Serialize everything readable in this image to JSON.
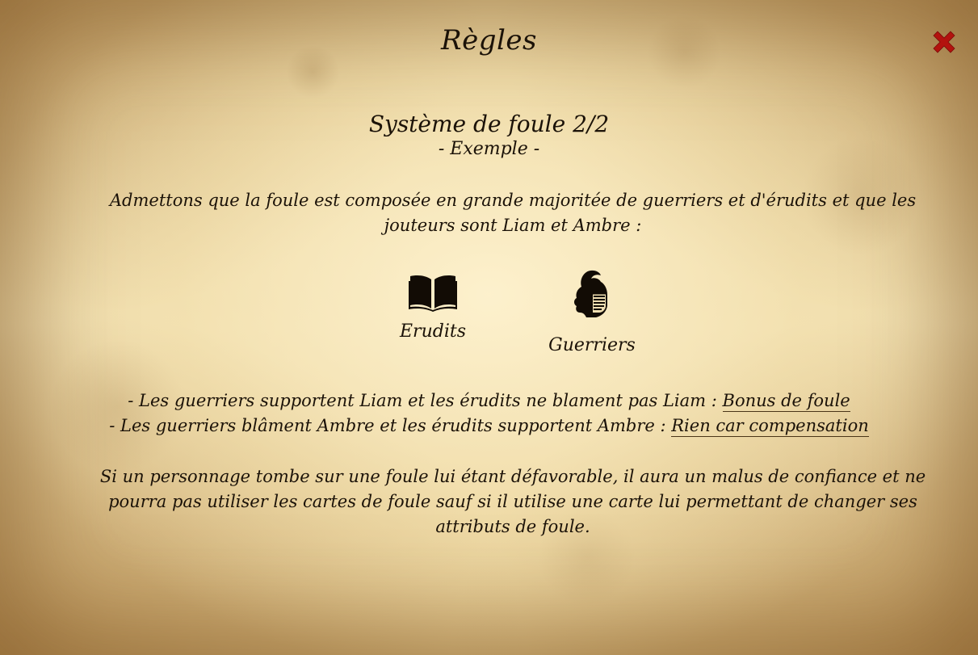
{
  "header": {
    "title": "Règles",
    "close_icon": "close-x-icon",
    "close_color": "#b3120e"
  },
  "section": {
    "title": "Système de foule 2/2",
    "subtitle": "- Exemple -"
  },
  "intro": "Admettons que la foule est composée en grande majoritée de guerriers et d'érudits et que les jouteurs sont Liam et Ambre :",
  "crowd_types": [
    {
      "icon": "open-book-icon",
      "label": "Erudits"
    },
    {
      "icon": "knight-helmet-icon",
      "label": "Guerriers"
    }
  ],
  "examples": [
    {
      "text": "- Les guerriers supportent Liam et les érudits ne blament pas Liam : ",
      "result": "Bonus de foule"
    },
    {
      "text": "- Les guerriers blâment Ambre et les érudits supportent Ambre : ",
      "result": "Rien car compensation"
    }
  ],
  "conclusion": "Si un personnage tombe sur une foule lui étant défavorable, il aura un malus de confiance et ne pourra pas utiliser les cartes de foule sauf si il utilise une carte lui permettant de changer ses attributs de foule."
}
